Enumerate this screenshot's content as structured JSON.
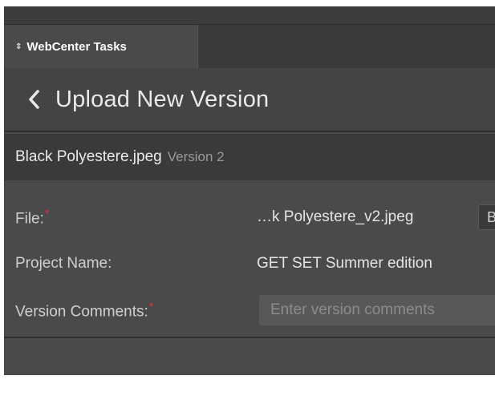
{
  "tab": {
    "icon": "⇕",
    "label": "WebCenter Tasks"
  },
  "header": {
    "title": "Upload New Version"
  },
  "document": {
    "filename": "Black Polyestere.jpeg",
    "version": "Version 2"
  },
  "form": {
    "file": {
      "label": "File:",
      "required_mark": "*",
      "value": "…k Polyestere_v2.jpeg",
      "browse_label": "B"
    },
    "project": {
      "label": "Project Name:",
      "value": "GET SET Summer edition"
    },
    "comments": {
      "label": "Version Comments:",
      "required_mark": "*",
      "placeholder": "Enter version comments",
      "value": ""
    }
  },
  "colors": {
    "required": "#e0303a",
    "panel": "#4a4a4a",
    "header": "#444444",
    "subheader": "#3a3a3a"
  },
  "icons": {
    "tab": "sort-arrows-icon",
    "back": "chevron-left-icon"
  }
}
